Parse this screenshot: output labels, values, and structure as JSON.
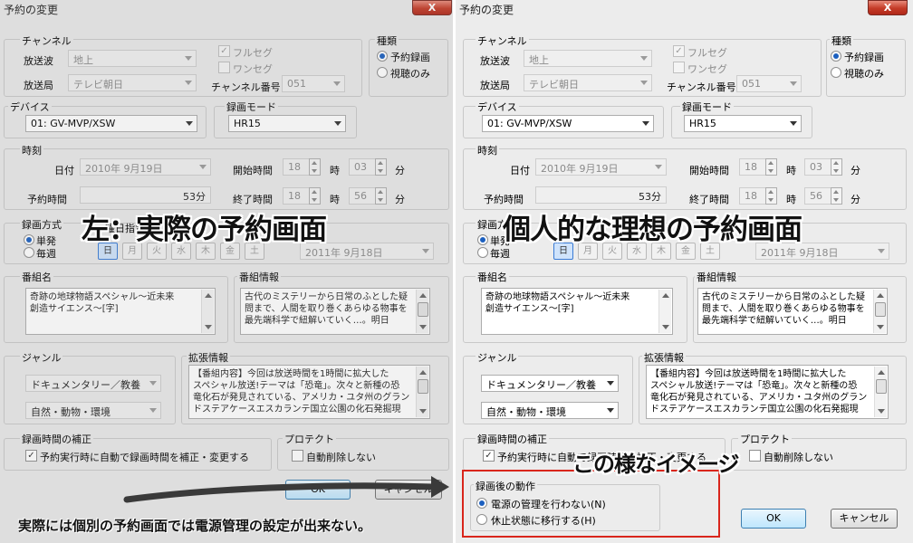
{
  "window_title": "予約の変更",
  "close_label": "X",
  "channel": {
    "group": "チャンネル",
    "broadcast_label": "放送波",
    "broadcast_value": "地上",
    "station_label": "放送局",
    "station_value": "テレビ朝日",
    "fullseg_label": "フルセグ",
    "oneseg_label": "ワンセグ",
    "number_label": "チャンネル番号",
    "number_value": "051"
  },
  "type": {
    "group": "種類",
    "reserve": "予約録画",
    "watch": "視聴のみ"
  },
  "device": {
    "group": "デバイス",
    "value": "01: GV-MVP/XSW"
  },
  "record_mode": {
    "group": "録画モード",
    "value": "HR15"
  },
  "time": {
    "group": "時刻",
    "date_label": "日付",
    "date_value": "2010年  9月19日",
    "start_label": "開始時間",
    "start_hour": "18",
    "start_min": "03",
    "end_label": "終了時間",
    "end_hour": "18",
    "end_min": "56",
    "hour_unit": "時",
    "min_unit": "分",
    "duration_label": "予約時間",
    "duration_value": "53分"
  },
  "method": {
    "group": "録画方式",
    "once": "単発",
    "weekly": "毎週",
    "day_specify": "曜日指定",
    "days": [
      "日",
      "月",
      "火",
      "水",
      "木",
      "金",
      "土"
    ],
    "until_date": "2011年  9月18日"
  },
  "program": {
    "name_group": "番組名",
    "name_text": "奇跡の地球物語スペシャル～近未来\n創造サイエンス～[字]",
    "info_group": "番組情報",
    "info_text": "古代のミステリーから日常のふとした疑\n問まで、人間を取り巻くあらゆる物事を\n最先端科学で紐解いていく…。明日"
  },
  "genre": {
    "group": "ジャンル",
    "genre1": "ドキュメンタリー／教養",
    "genre2": "自然・動物・環境"
  },
  "extended": {
    "group": "拡張情報",
    "text": "【番組内容】今回は放送時間を1時間に拡大した\nスペシャル放送!テーマは「恐竜」。次々と新種の恐\n竜化石が発見されている、アメリカ・ユタ州のグラン\nドステアケースエスカランテ国立公園の化石発掘現"
  },
  "correction": {
    "group": "録画時間の補正",
    "auto_label": "予約実行時に自動で録画時間を補正・変更する"
  },
  "protect": {
    "group": "プロテクト",
    "no_delete": "自動削除しない"
  },
  "after_action": {
    "group": "録画後の動作",
    "option1": "電源の管理を行わない(N)",
    "option2": "休止状態に移行する(H)"
  },
  "buttons": {
    "ok": "OK",
    "cancel": "キャンセル"
  },
  "annotations": {
    "left_caption": "左：実際の予約画面",
    "right_caption": "個人的な理想の予約画面",
    "image_caption": "この様なイメージ",
    "footer": "実際には個別の予約画面では電源管理の設定が出来ない。"
  }
}
